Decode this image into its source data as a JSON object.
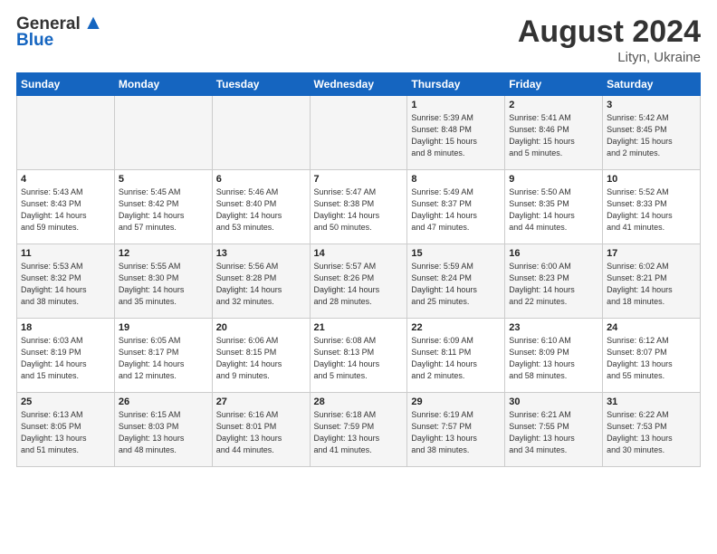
{
  "logo": {
    "general": "General",
    "blue": "Blue"
  },
  "header": {
    "title": "August 2024",
    "subtitle": "Lityn, Ukraine"
  },
  "weekdays": [
    "Sunday",
    "Monday",
    "Tuesday",
    "Wednesday",
    "Thursday",
    "Friday",
    "Saturday"
  ],
  "weeks": [
    [
      {
        "day": "",
        "info": ""
      },
      {
        "day": "",
        "info": ""
      },
      {
        "day": "",
        "info": ""
      },
      {
        "day": "",
        "info": ""
      },
      {
        "day": "1",
        "info": "Sunrise: 5:39 AM\nSunset: 8:48 PM\nDaylight: 15 hours\nand 8 minutes."
      },
      {
        "day": "2",
        "info": "Sunrise: 5:41 AM\nSunset: 8:46 PM\nDaylight: 15 hours\nand 5 minutes."
      },
      {
        "day": "3",
        "info": "Sunrise: 5:42 AM\nSunset: 8:45 PM\nDaylight: 15 hours\nand 2 minutes."
      }
    ],
    [
      {
        "day": "4",
        "info": "Sunrise: 5:43 AM\nSunset: 8:43 PM\nDaylight: 14 hours\nand 59 minutes."
      },
      {
        "day": "5",
        "info": "Sunrise: 5:45 AM\nSunset: 8:42 PM\nDaylight: 14 hours\nand 57 minutes."
      },
      {
        "day": "6",
        "info": "Sunrise: 5:46 AM\nSunset: 8:40 PM\nDaylight: 14 hours\nand 53 minutes."
      },
      {
        "day": "7",
        "info": "Sunrise: 5:47 AM\nSunset: 8:38 PM\nDaylight: 14 hours\nand 50 minutes."
      },
      {
        "day": "8",
        "info": "Sunrise: 5:49 AM\nSunset: 8:37 PM\nDaylight: 14 hours\nand 47 minutes."
      },
      {
        "day": "9",
        "info": "Sunrise: 5:50 AM\nSunset: 8:35 PM\nDaylight: 14 hours\nand 44 minutes."
      },
      {
        "day": "10",
        "info": "Sunrise: 5:52 AM\nSunset: 8:33 PM\nDaylight: 14 hours\nand 41 minutes."
      }
    ],
    [
      {
        "day": "11",
        "info": "Sunrise: 5:53 AM\nSunset: 8:32 PM\nDaylight: 14 hours\nand 38 minutes."
      },
      {
        "day": "12",
        "info": "Sunrise: 5:55 AM\nSunset: 8:30 PM\nDaylight: 14 hours\nand 35 minutes."
      },
      {
        "day": "13",
        "info": "Sunrise: 5:56 AM\nSunset: 8:28 PM\nDaylight: 14 hours\nand 32 minutes."
      },
      {
        "day": "14",
        "info": "Sunrise: 5:57 AM\nSunset: 8:26 PM\nDaylight: 14 hours\nand 28 minutes."
      },
      {
        "day": "15",
        "info": "Sunrise: 5:59 AM\nSunset: 8:24 PM\nDaylight: 14 hours\nand 25 minutes."
      },
      {
        "day": "16",
        "info": "Sunrise: 6:00 AM\nSunset: 8:23 PM\nDaylight: 14 hours\nand 22 minutes."
      },
      {
        "day": "17",
        "info": "Sunrise: 6:02 AM\nSunset: 8:21 PM\nDaylight: 14 hours\nand 18 minutes."
      }
    ],
    [
      {
        "day": "18",
        "info": "Sunrise: 6:03 AM\nSunset: 8:19 PM\nDaylight: 14 hours\nand 15 minutes."
      },
      {
        "day": "19",
        "info": "Sunrise: 6:05 AM\nSunset: 8:17 PM\nDaylight: 14 hours\nand 12 minutes."
      },
      {
        "day": "20",
        "info": "Sunrise: 6:06 AM\nSunset: 8:15 PM\nDaylight: 14 hours\nand 9 minutes."
      },
      {
        "day": "21",
        "info": "Sunrise: 6:08 AM\nSunset: 8:13 PM\nDaylight: 14 hours\nand 5 minutes."
      },
      {
        "day": "22",
        "info": "Sunrise: 6:09 AM\nSunset: 8:11 PM\nDaylight: 14 hours\nand 2 minutes."
      },
      {
        "day": "23",
        "info": "Sunrise: 6:10 AM\nSunset: 8:09 PM\nDaylight: 13 hours\nand 58 minutes."
      },
      {
        "day": "24",
        "info": "Sunrise: 6:12 AM\nSunset: 8:07 PM\nDaylight: 13 hours\nand 55 minutes."
      }
    ],
    [
      {
        "day": "25",
        "info": "Sunrise: 6:13 AM\nSunset: 8:05 PM\nDaylight: 13 hours\nand 51 minutes."
      },
      {
        "day": "26",
        "info": "Sunrise: 6:15 AM\nSunset: 8:03 PM\nDaylight: 13 hours\nand 48 minutes."
      },
      {
        "day": "27",
        "info": "Sunrise: 6:16 AM\nSunset: 8:01 PM\nDaylight: 13 hours\nand 44 minutes."
      },
      {
        "day": "28",
        "info": "Sunrise: 6:18 AM\nSunset: 7:59 PM\nDaylight: 13 hours\nand 41 minutes."
      },
      {
        "day": "29",
        "info": "Sunrise: 6:19 AM\nSunset: 7:57 PM\nDaylight: 13 hours\nand 38 minutes."
      },
      {
        "day": "30",
        "info": "Sunrise: 6:21 AM\nSunset: 7:55 PM\nDaylight: 13 hours\nand 34 minutes."
      },
      {
        "day": "31",
        "info": "Sunrise: 6:22 AM\nSunset: 7:53 PM\nDaylight: 13 hours\nand 30 minutes."
      }
    ]
  ]
}
